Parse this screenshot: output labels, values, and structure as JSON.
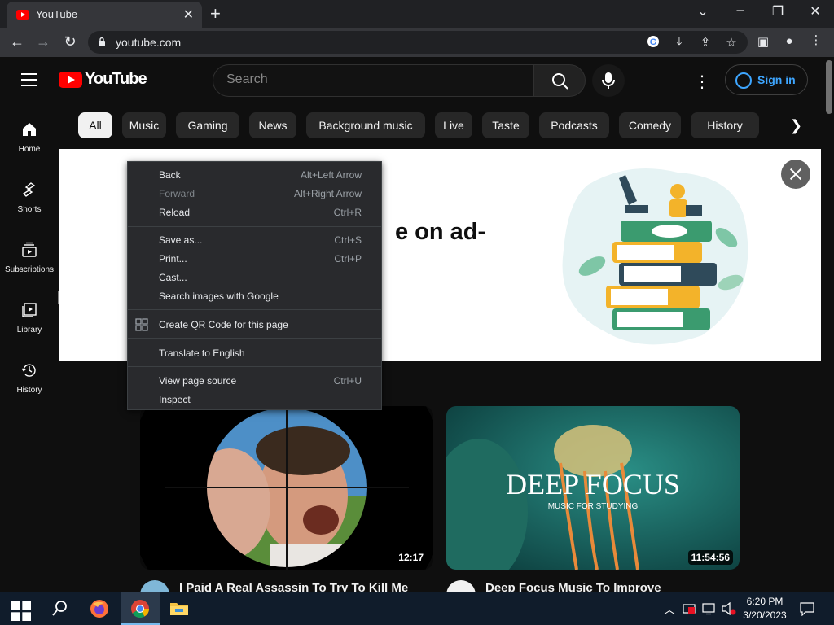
{
  "browser": {
    "tab_title": "YouTube",
    "url": "youtube.com"
  },
  "header": {
    "logo_text": "YouTube",
    "search_placeholder": "Search",
    "signin_label": "Sign in"
  },
  "chips": [
    "All",
    "Music",
    "Gaming",
    "News",
    "Background music",
    "Live",
    "Taste",
    "Podcasts",
    "Comedy",
    "History"
  ],
  "sidebar": {
    "items": [
      {
        "label": "Home",
        "icon": "home-icon"
      },
      {
        "label": "Shorts",
        "icon": "shorts-icon"
      },
      {
        "label": "Subscriptions",
        "icon": "subscriptions-icon"
      },
      {
        "label": "Library",
        "icon": "library-icon"
      },
      {
        "label": "History",
        "icon": "history-icon"
      }
    ]
  },
  "banner": {
    "headline_fragment": "e on ad-"
  },
  "context_menu": {
    "items": [
      {
        "label": "Back",
        "shortcut": "Alt+Left Arrow",
        "disabled": false
      },
      {
        "label": "Forward",
        "shortcut": "Alt+Right Arrow",
        "disabled": true
      },
      {
        "label": "Reload",
        "shortcut": "Ctrl+R",
        "disabled": false
      },
      {
        "label": "Save as...",
        "shortcut": "Ctrl+S",
        "disabled": false
      },
      {
        "label": "Print...",
        "shortcut": "Ctrl+P",
        "disabled": false
      },
      {
        "label": "Cast...",
        "shortcut": "",
        "disabled": false
      },
      {
        "label": "Search images with Google",
        "shortcut": "",
        "disabled": false
      },
      {
        "label": "Create QR Code for this page",
        "shortcut": "",
        "disabled": false
      },
      {
        "label": "Translate to English",
        "shortcut": "",
        "disabled": false
      },
      {
        "label": "View page source",
        "shortcut": "Ctrl+U",
        "disabled": false
      },
      {
        "label": "Inspect",
        "shortcut": "",
        "disabled": false
      }
    ]
  },
  "videos": [
    {
      "title": "I Paid A Real Assassin To Try To Kill Me",
      "duration": "12:17",
      "thumb_text": ""
    },
    {
      "title": "Deep Focus Music To Improve",
      "duration": "11:54:56",
      "thumb_text": "DEEP FOCUS",
      "thumb_subtext": "MUSIC FOR STUDYING"
    }
  ],
  "taskbar": {
    "time": "6:20 PM",
    "date": "3/20/2023"
  },
  "colors": {
    "yt_red": "#ff0000",
    "link_blue": "#3ea6ff",
    "bg": "#0f0f0f"
  }
}
